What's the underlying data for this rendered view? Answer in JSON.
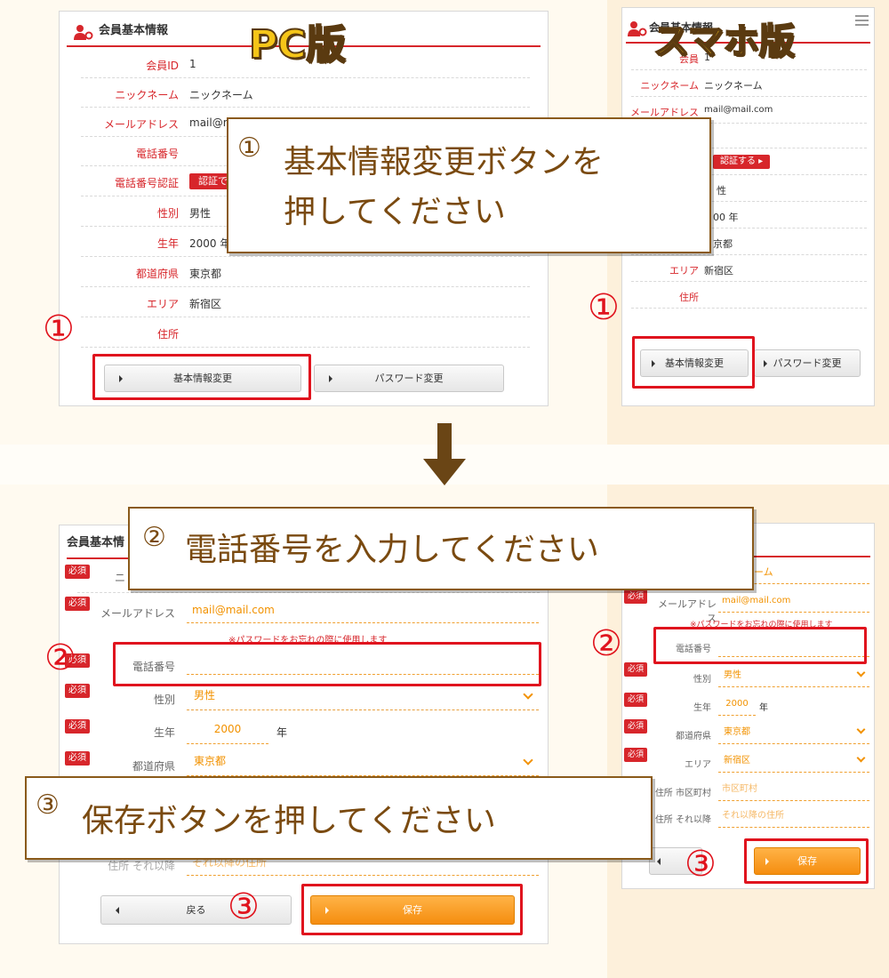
{
  "labels": {
    "pc": "PC版",
    "sp": "スマホ版"
  },
  "colors": {
    "accent": "#d7262b",
    "orange": "#f29200",
    "callout_text": "#7a4a10"
  },
  "callouts": {
    "c1": {
      "num": "①",
      "line1": "基本情報変更ボタンを",
      "line2": "押してください"
    },
    "c2": {
      "num": "②",
      "text": "電話番号を入力してください"
    },
    "c3": {
      "num": "③",
      "text": "保存ボタンを押してください"
    }
  },
  "markers": {
    "m1": "①",
    "m2": "②",
    "m3": "③"
  },
  "top_pc": {
    "title": "会員基本情報",
    "rows": [
      {
        "label": "会員ID",
        "value": "1"
      },
      {
        "label": "ニックネーム",
        "value": "ニックネーム"
      },
      {
        "label": "メールアドレス",
        "value": "mail@m"
      },
      {
        "label": "電話番号",
        "value": ""
      },
      {
        "label": "電話番号認証",
        "value": ""
      },
      {
        "label": "性別",
        "value": "男性"
      },
      {
        "label": "生年",
        "value": "2000 年"
      },
      {
        "label": "都道府県",
        "value": "東京都"
      },
      {
        "label": "エリア",
        "value": "新宿区"
      },
      {
        "label": "住所",
        "value": ""
      }
    ],
    "auth_button": "認証で",
    "btn_basic": "基本情報変更",
    "btn_password": "パスワード変更"
  },
  "top_sp": {
    "title": "会員基本情報",
    "rows": [
      {
        "label": "会員",
        "value": "1"
      },
      {
        "label": "ニックネーム",
        "value": "ニックネーム"
      },
      {
        "label": "メールアドレス",
        "value": "mail@mail.com"
      },
      {
        "label": "",
        "value": "性"
      },
      {
        "label": "",
        "value": "00 年"
      },
      {
        "label": "",
        "value": "京都"
      },
      {
        "label": "エリア",
        "value": "新宿区"
      },
      {
        "label": "住所",
        "value": ""
      }
    ],
    "auth_button": "認証する",
    "btn_basic": "基本情報変更",
    "btn_password": "パスワード変更"
  },
  "bottom_pc": {
    "title": "会員基本情",
    "required": "必須",
    "nick_label": "ニ",
    "email_label": "メールアドレス",
    "email_value": "mail@mail.com",
    "note": "※パスワードをお忘れの際に使用します",
    "phone_label": "電話番号",
    "phone_value": "",
    "gender_label": "性別",
    "gender_value": "男性",
    "year_label": "生年",
    "year_value": "2000",
    "year_unit": "年",
    "pref_label": "都道府県",
    "pref_value": "東京都",
    "addr2_label": "住所 それ以降",
    "addr2_placeholder": "それ以降の住所",
    "btn_back": "戻る",
    "btn_save": "保存"
  },
  "bottom_sp": {
    "required": "必須",
    "nick_value": "ーム",
    "email_label": "メールアドレス",
    "email_value": "mail@mail.com",
    "note": "※パスワードをお忘れの際に使用します",
    "phone_label": "電話番号",
    "gender_label": "性別",
    "gender_value": "男性",
    "year_label": "生年",
    "year_value": "2000",
    "year_unit": "年",
    "pref_label": "都道府県",
    "pref_value": "東京都",
    "area_label": "エリア",
    "area_value": "新宿区",
    "addr1_label": "住所 市区町村",
    "addr1_placeholder": "市区町村",
    "addr2_label": "住所 それ以降",
    "addr2_placeholder": "それ以降の住所",
    "btn_save": "保存"
  }
}
